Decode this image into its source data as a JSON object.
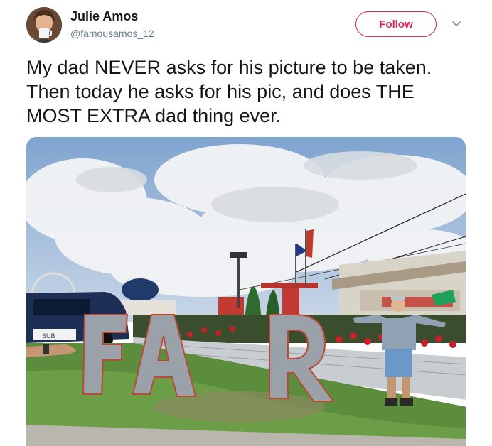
{
  "author": {
    "name": "Julie Amos",
    "handle": "@famousamos_12"
  },
  "follow_label": "Follow",
  "tweet": {
    "text": "My dad NEVER asks for his picture to be taken. Then today he asks for his pic, and does THE MOST EXTRA dad thing ever."
  },
  "media": {
    "letters": [
      "F",
      "A",
      "R"
    ],
    "photo_label_text": "SUB"
  },
  "colors": {
    "follow_accent": "#e0245e",
    "name_text": "#14171a",
    "handle_text": "#657786"
  },
  "icons": {
    "chevron": "chevron-down-icon"
  }
}
